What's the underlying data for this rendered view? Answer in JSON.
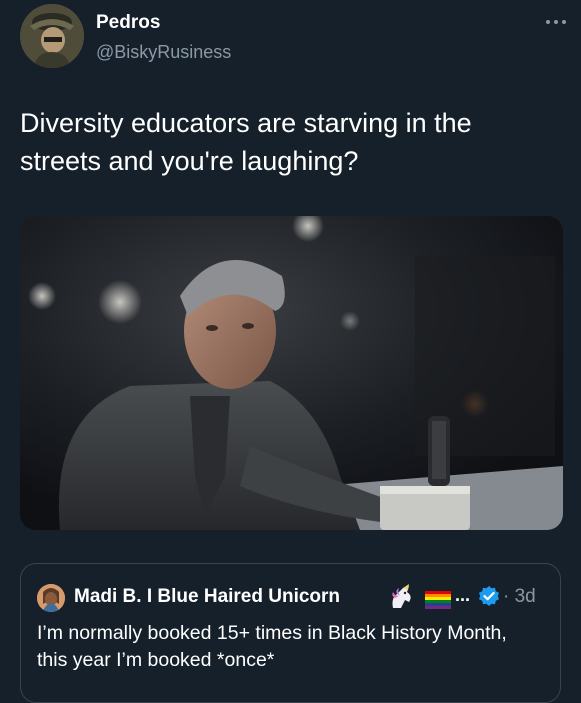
{
  "tweet": {
    "display_name": "Pedros",
    "handle": "@BiskyRusiness",
    "more_icon": "more-horizontal-icon",
    "text": "Diversity educators are starving in the streets and you're laughing?",
    "media": {
      "type": "photo"
    }
  },
  "quoted_tweet": {
    "display_name": "Madi B. I Blue Haired Unicorn",
    "emoji": [
      "unicorn-icon",
      "rainbow-flag-icon"
    ],
    "ellipsis": "...",
    "verified_icon": "verified-badge-icon",
    "timestamp": "· 3d",
    "text": "I’m normally booked 15+ times in Black History Month, this year I’m booked *once*"
  },
  "colors": {
    "background": "#15202b",
    "text_primary": "#ffffff",
    "text_secondary": "#8b98a5",
    "border": "#38444d",
    "verified": "#1d9bf0"
  }
}
